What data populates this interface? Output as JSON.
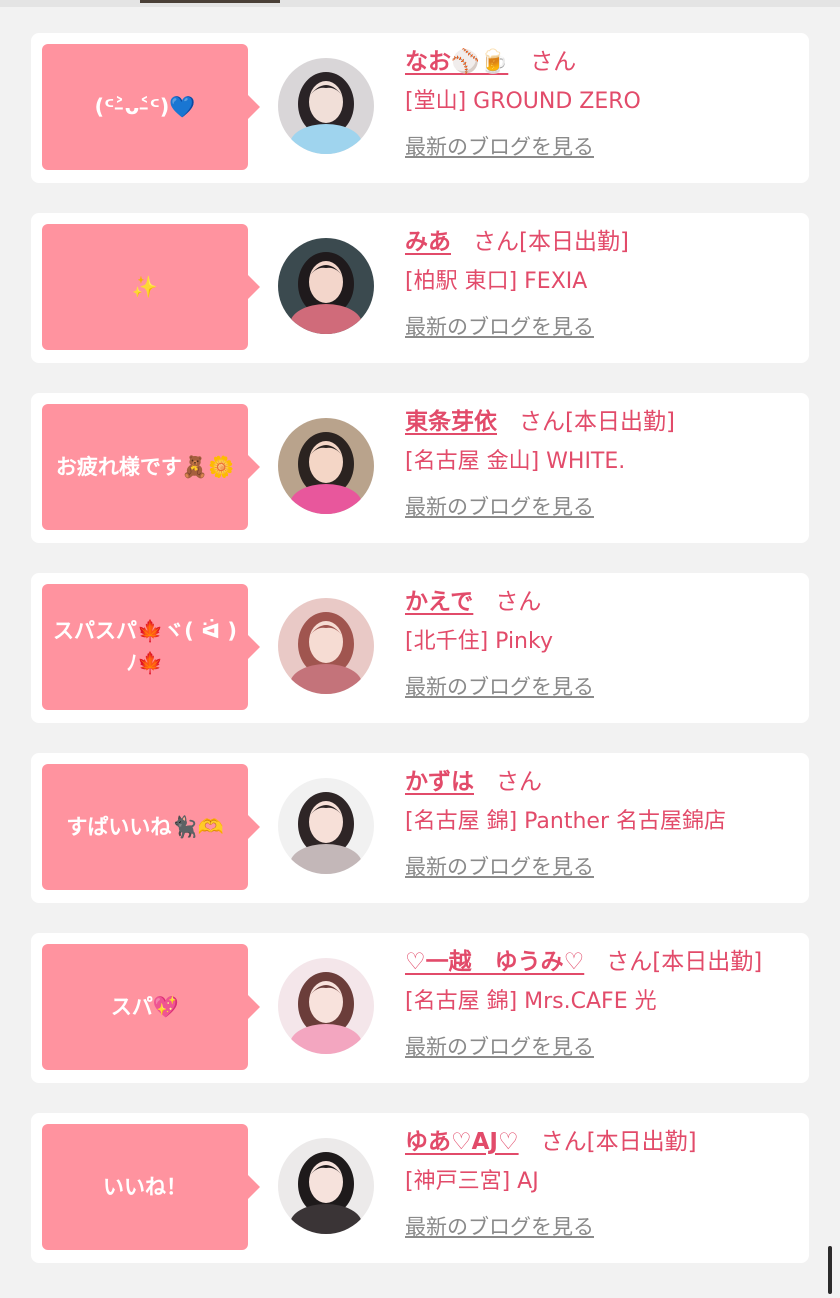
{
  "link_label": "最新のブログを見る",
  "honorific": "さん",
  "cards": [
    {
      "message": "(ᑦ˃̵ᴗ˂̵ᑦ)💙",
      "name": "なお⚾️🍺",
      "status": "",
      "shop": "[堂山] GROUND ZERO",
      "avatar": {
        "bg": "#d9d6d8",
        "hair": "#2a2326",
        "skin": "#f1dfd8",
        "accent": "#9fd4ee"
      }
    },
    {
      "message": "✨",
      "name": "みあ",
      "status": "[本日出勤]",
      "shop": "[柏駅 東口] FEXIA",
      "avatar": {
        "bg": "#3b4a4f",
        "hair": "#1f1a1c",
        "skin": "#f3d6cb",
        "accent": "#d06b7a"
      }
    },
    {
      "message": "お疲れ様です🧸🌼",
      "name": "東条芽依",
      "status": "[本日出勤]",
      "shop": "[名古屋 金山] WHITE.",
      "avatar": {
        "bg": "#b9a38c",
        "hair": "#2b2320",
        "skin": "#f4d6c6",
        "accent": "#e8579c"
      }
    },
    {
      "message": "スパスパ🍁ヾ( ᐛ )ﾉ🍁",
      "name": "かえで",
      "status": "",
      "shop": "[北千住] Pinky",
      "avatar": {
        "bg": "#e9c9c6",
        "hair": "#a0554f",
        "skin": "#f6dcd3",
        "accent": "#c4737a"
      }
    },
    {
      "message": "すぱいいね🐈‍⬛🫶",
      "name": "かずは",
      "status": "",
      "shop": "[名古屋 錦] Panther 名古屋錦店",
      "avatar": {
        "bg": "#f1f1f1",
        "hair": "#2e2526",
        "skin": "#f7e0d8",
        "accent": "#c3b7b8"
      }
    },
    {
      "message": "スパ💖",
      "name": "♡一越　ゆうみ♡",
      "status": "[本日出勤]",
      "shop": "[名古屋 錦] Mrs.CAFE 光",
      "avatar": {
        "bg": "#f4e6ea",
        "hair": "#6b3d3a",
        "skin": "#f8e2dc",
        "accent": "#f3a6c0"
      }
    },
    {
      "message": "いいね！",
      "name": "ゆあ♡AJ♡",
      "status": "[本日出勤]",
      "shop": "[神戸三宮] AJ",
      "avatar": {
        "bg": "#eceaea",
        "hair": "#1e1a1b",
        "skin": "#f6e2dc",
        "accent": "#3a3436"
      }
    }
  ]
}
